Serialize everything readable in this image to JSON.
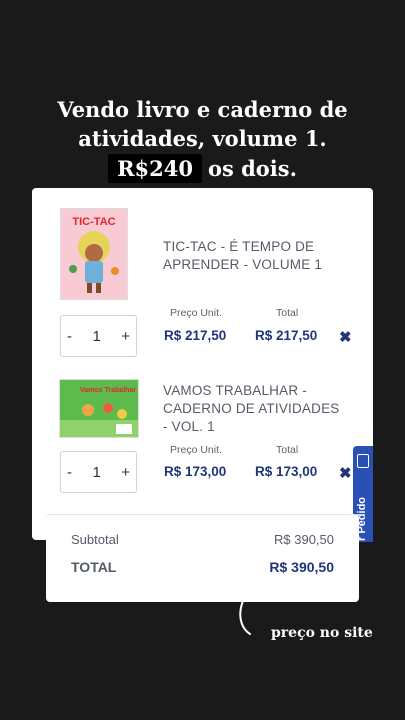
{
  "headline": {
    "line1": "Vendo livro e caderno de",
    "line2": "atividades, volume 1.",
    "price": "R$240",
    "line3_rest": "os dois."
  },
  "cart": {
    "items": [
      {
        "title_line1": "TIC-TAC - É TEMPO DE",
        "title_line2": "APRENDER - VOLUME 1",
        "cover_text": "TIC-TAC",
        "quantity": "1",
        "unit_label": "Preço Unit.",
        "total_label": "Total",
        "unit_price": "R$ 217,50",
        "total_price": "R$ 217,50"
      },
      {
        "title_line1": "VAMOS TRABALHAR -",
        "title_line2": "CADERNO DE ATIVIDADES",
        "title_line3": "- VOL. 1",
        "cover_text": "Vamos Trabalhar",
        "quantity": "1",
        "unit_label": "Preço Unit.",
        "total_label": "Total",
        "unit_price": "R$ 173,00",
        "total_price": "R$ 173,00"
      }
    ],
    "minus": "-",
    "plus": "+",
    "remove": "✖"
  },
  "side_tab": {
    "label": "r Pedido"
  },
  "summary": {
    "subtotal_label": "Subtotal",
    "subtotal_value": "R$ 390,50",
    "total_label": "TOTAL",
    "total_value": "R$ 390,50"
  },
  "note": "preço no site",
  "colors": {
    "accent": "#22357a",
    "tab": "#2a50b5",
    "background": "#1b1a1a"
  }
}
